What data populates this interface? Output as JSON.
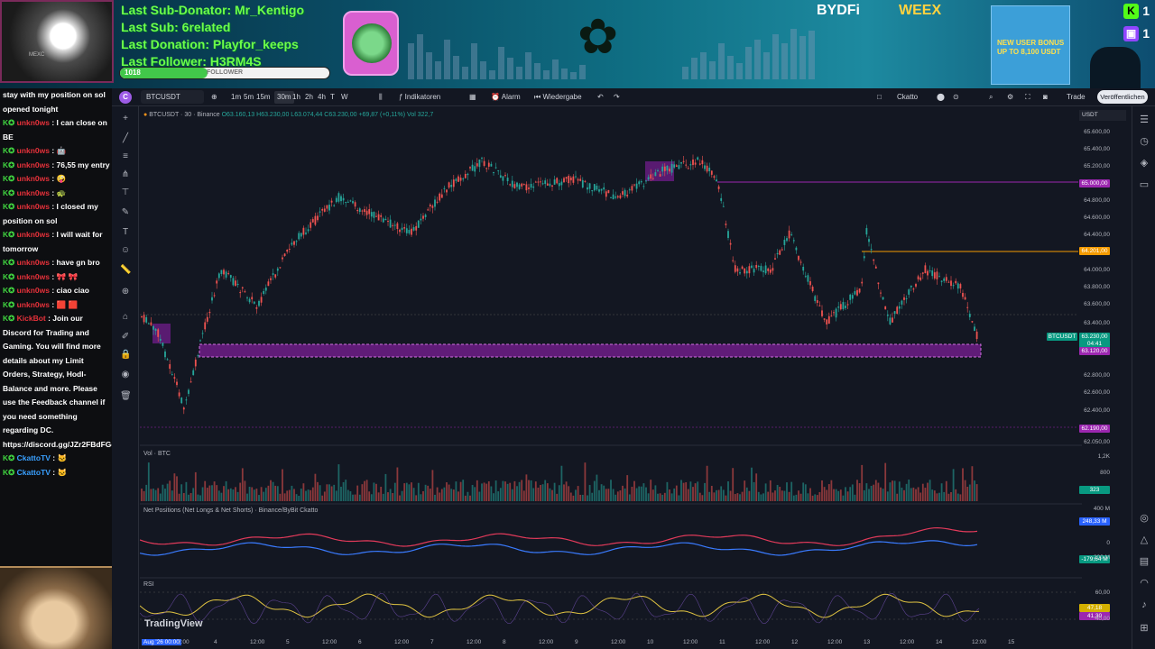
{
  "overlay": {
    "last_sub_donator": "Last Sub-Donator: Mr_Kentigo",
    "last_sub": "Last Sub: 6related",
    "last_donation": "Last Donation: Playfor_keeps",
    "last_follower": "Last Follower: H3RM4S",
    "follower_count": "1018",
    "follower_label": "FOLLOWER",
    "follower_progress": 0.42,
    "sponsor1": "BYDFi",
    "sponsor2": "WEEX",
    "promo": "NEW USER BONUS UP TO 8,100 USDT",
    "kick_count": "1",
    "twitch_count": "1"
  },
  "chat": [
    {
      "text": "stay with my position on sol opened tonight"
    },
    {
      "user": "unkn0ws",
      "msg": " : I can close on BE"
    },
    {
      "user": "unkn0ws",
      "msg": " : 🤖"
    },
    {
      "user": "unkn0ws",
      "msg": " : 76,55 my entry"
    },
    {
      "user": "unkn0ws",
      "msg": " : 🤪"
    },
    {
      "user": "unkn0ws",
      "msg": " : 🐢"
    },
    {
      "user": "unkn0ws",
      "msg": " : I closed my position on sol"
    },
    {
      "user": "unkn0ws",
      "msg": " : I will wait for tomorrow"
    },
    {
      "user": "unkn0ws",
      "msg": " : have gn bro"
    },
    {
      "user": "unkn0ws",
      "msg": " : 🎀 🎀"
    },
    {
      "user": "unkn0ws",
      "msg": " : ciao ciao"
    },
    {
      "user": "unkn0ws",
      "msg": " : 🟥 🟥"
    },
    {
      "user": "KickBot",
      "msg": " : Join our Discord for Trading and Gaming. You will find more details about my Limit Orders, Strategy, Hodl-Balance and more. Please use the Feedback channel if you need something regarding DC. https://discord.gg/JZr2FBdFGe"
    },
    {
      "user": "CkattoTV",
      "msg": " : 🐱"
    },
    {
      "user": "CkattoTV",
      "msg": " : 🐱"
    }
  ],
  "toolbar": {
    "symbol": "BTCUSDT",
    "intervals": [
      "1m",
      "5m",
      "15m",
      "30m",
      "1h",
      "2h",
      "4h",
      "T",
      "W"
    ],
    "active_interval": "30m",
    "indicators": "Indikatoren",
    "alarm": "Alarm",
    "replay": "Wiedergabe",
    "account": "Ckatto",
    "trade": "Trade",
    "publish": "Veröffentlichen"
  },
  "legend": {
    "title": "BTCUSDT · 30 · Binance",
    "o": "O63.160,13",
    "h": "H63.230,00",
    "l": "L63.074,44",
    "c": "C63.230,00",
    "chg": "+69,87 (+0,11%)",
    "vol": "Vol 322,7"
  },
  "panes": {
    "volume_label": "Vol · BTC",
    "net_positions_label": "Net Positions (Net Longs & Net Shorts) · Binance/ByBit Ckatto",
    "rsi_label": "RSI"
  },
  "watermark": "TradingView",
  "price_axis": {
    "currency": "USDT",
    "levels": [
      "65.600,00",
      "65.400,00",
      "65.200,00",
      "64.800,00",
      "64.600,00",
      "64.400,00",
      "64.000,00",
      "63.800,00",
      "63.600,00",
      "63.400,00",
      "62.800,00",
      "62.600,00",
      "62.400,00",
      "62.050,00"
    ],
    "tag_65000": "65.000,00",
    "tag_64201": "64.201,00",
    "tag_symbol": "BTCUSDT",
    "tag_last": "63.230,00",
    "tag_timer": "04:41",
    "tag_63120": "63.120,00",
    "tag_62190": "62.190,00",
    "vol_levels": [
      "1,2K",
      "800"
    ],
    "vol_tag": "323",
    "np_levels": [
      "400 M",
      "0",
      "-200 M"
    ],
    "np_tag1": "248,33 M",
    "np_tag2": "-179,64 M",
    "rsi_levels": [
      "60,00",
      "40,00"
    ],
    "rsi_tag1": "47,18",
    "rsi_tag2": "41,30"
  },
  "time_axis": [
    "Aug '26  00:00",
    "2:00",
    "4",
    "12:00",
    "5",
    "12:00",
    "6",
    "12:00",
    "7",
    "12:00",
    "8",
    "12:00",
    "9",
    "12:00",
    "10",
    "12:00",
    "11",
    "12:00",
    "12",
    "12:00",
    "13",
    "12:00",
    "14",
    "12:00",
    "15"
  ],
  "colors": {
    "up": "#26a69a",
    "down": "#ef5350",
    "zone": "#a020c0",
    "level_orange": "#f59b00",
    "level_purple": "#9c27b0",
    "rsi": "#e0c341"
  }
}
